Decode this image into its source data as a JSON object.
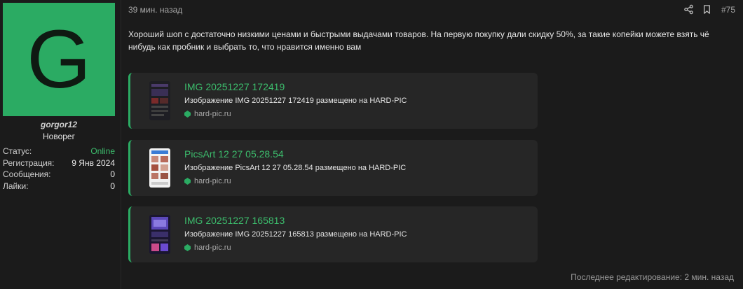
{
  "user": {
    "avatar_letter": "G",
    "avatar_color": "#2bab63",
    "username": "gorgor12",
    "role": "Новорег",
    "stats": [
      {
        "label": "Статус:",
        "value": "Online"
      },
      {
        "label": "Регистрация:",
        "value": "9 Янв 2024"
      },
      {
        "label": "Сообщения:",
        "value": "0"
      },
      {
        "label": "Лайки:",
        "value": "0"
      }
    ]
  },
  "post": {
    "time": "39 мин. назад",
    "number": "#75",
    "text": "Хороший шоп с достаточно низкими ценами и быстрыми выдачами товаров. На первую покупку дали скидку 50%, за такие копейки можете взять чё нибудь как пробник и выбрать то, что нравится именно вам",
    "embeds": [
      {
        "title": "IMG 20251227 172419",
        "description": "Изображение IMG 20251227 172419 размещено на HARD-PIC",
        "site": "hard-pic.ru"
      },
      {
        "title": "PicsArt 12 27 05.28.54",
        "description": "Изображение PicsArt 12 27 05.28.54 размещено на HARD-PIC",
        "site": "hard-pic.ru"
      },
      {
        "title": "IMG 20251227 165813",
        "description": "Изображение IMG 20251227 165813 размещено на HARD-PIC",
        "site": "hard-pic.ru"
      }
    ],
    "edited": "Последнее редактирование: 2 мин. назад"
  },
  "colors": {
    "accent": "#2bab63",
    "link": "#3cbc6c",
    "background": "#1b1b1b",
    "card": "#262626"
  },
  "icons": [
    "share-icon",
    "bookmark-icon",
    "site-favicon-icon"
  ]
}
